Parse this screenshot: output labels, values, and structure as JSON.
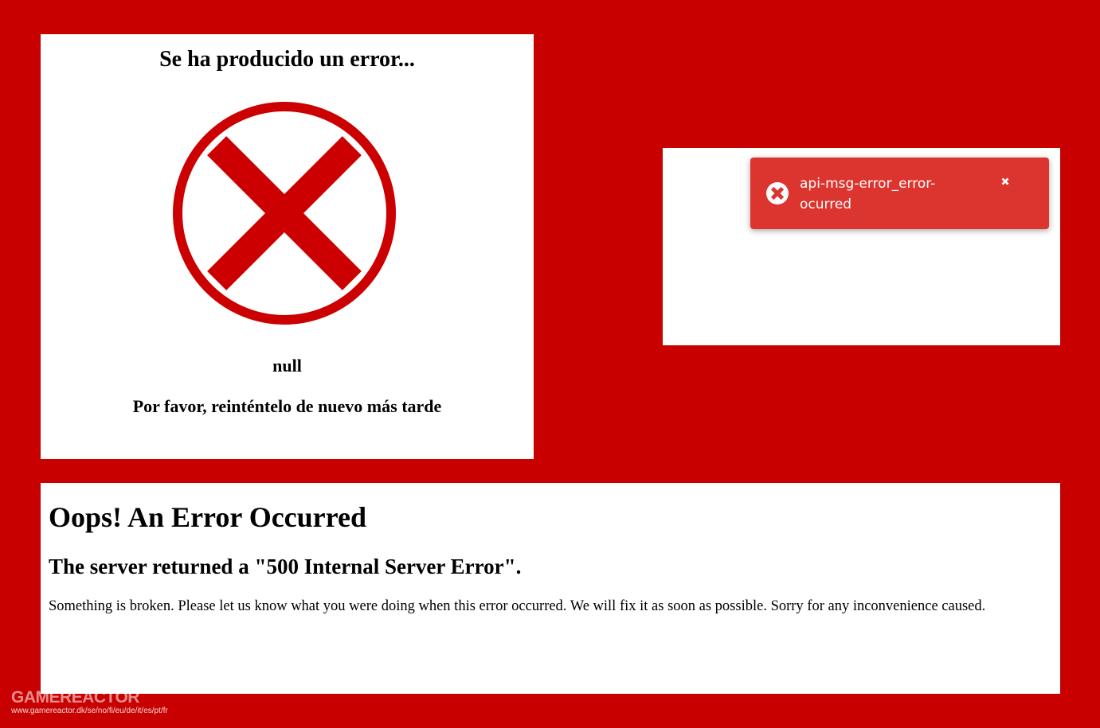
{
  "colors": {
    "background": "#c90000",
    "error_red": "#cc0000",
    "toast_red": "#dc342e",
    "panel": "#ffffff"
  },
  "spanish_error": {
    "title": "Se ha producido un error...",
    "icon": "circle-x-icon",
    "detail": "null",
    "retry_message": "Por favor, reinténtelo de nuevo más tarde"
  },
  "toast": {
    "icon": "error-circle-icon",
    "message": "api-msg-error_error-ocurred",
    "close_icon": "close-icon"
  },
  "english_error": {
    "heading": "Oops! An Error Occurred",
    "subheading": "The server returned a \"500 Internal Server Error\".",
    "body": "Something is broken. Please let us know what you were doing when this error occurred. We will fix it as soon as possible. Sorry for any inconvenience caused."
  },
  "watermark": {
    "brand": "GAMEREACTOR",
    "sites": "www.gamereactor.dk/se/no/fi/eu/de/it/es/pt/fr"
  }
}
